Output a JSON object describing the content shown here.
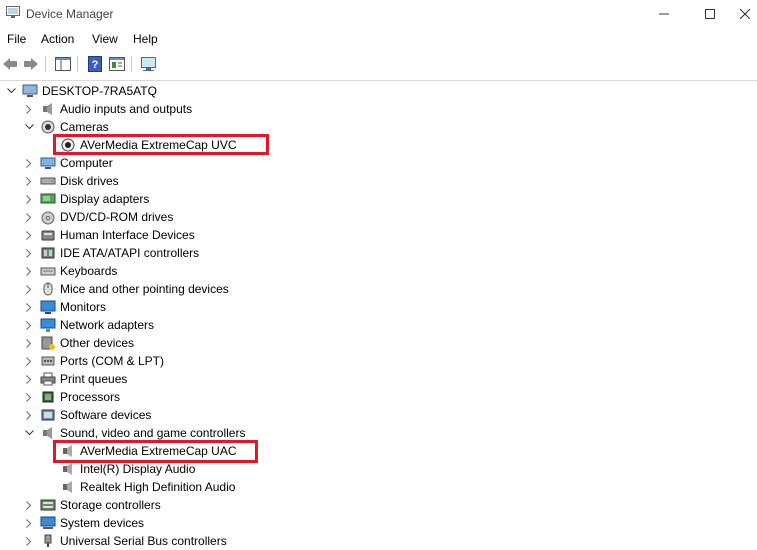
{
  "window": {
    "title": "Device Manager"
  },
  "menu": [
    "File",
    "Action",
    "View",
    "Help"
  ],
  "tree": {
    "root": "DESKTOP-7RA5ATQ",
    "items": [
      {
        "label": "Audio inputs and outputs",
        "icon": "speaker-icon",
        "expanded": false
      },
      {
        "label": "Cameras",
        "icon": "camera-icon",
        "expanded": true
      },
      {
        "label": "AVerMedia ExtremeCap UVC",
        "icon": "webcam-icon",
        "child": true
      },
      {
        "label": "Computer",
        "icon": "computer-icon",
        "expanded": false
      },
      {
        "label": "Disk drives",
        "icon": "disk-drive-icon",
        "expanded": false
      },
      {
        "label": "Display adapters",
        "icon": "display-adapter-icon",
        "expanded": false
      },
      {
        "label": "DVD/CD-ROM drives",
        "icon": "dvd-drive-icon",
        "expanded": false
      },
      {
        "label": "Human Interface Devices",
        "icon": "hid-icon",
        "expanded": false
      },
      {
        "label": "IDE ATA/ATAPI controllers",
        "icon": "ide-controller-icon",
        "expanded": false
      },
      {
        "label": "Keyboards",
        "icon": "keyboard-icon",
        "expanded": false
      },
      {
        "label": "Mice and other pointing devices",
        "icon": "mouse-icon",
        "expanded": false
      },
      {
        "label": "Monitors",
        "icon": "monitor-icon",
        "expanded": false
      },
      {
        "label": "Network adapters",
        "icon": "network-adapter-icon",
        "expanded": false
      },
      {
        "label": "Other devices",
        "icon": "other-devices-icon",
        "expanded": false
      },
      {
        "label": "Ports (COM & LPT)",
        "icon": "port-icon",
        "expanded": false
      },
      {
        "label": "Print queues",
        "icon": "printer-icon",
        "expanded": false
      },
      {
        "label": "Processors",
        "icon": "processor-icon",
        "expanded": false
      },
      {
        "label": "Software devices",
        "icon": "software-device-icon",
        "expanded": false
      },
      {
        "label": "Sound, video and game controllers",
        "icon": "sound-controller-icon",
        "expanded": true
      },
      {
        "label": "AVerMedia ExtremeCap UAC",
        "icon": "audio-device-icon",
        "child": true
      },
      {
        "label": "Intel(R) Display Audio",
        "icon": "audio-device-icon",
        "child": true
      },
      {
        "label": "Realtek High Definition Audio",
        "icon": "audio-device-icon",
        "child": true
      },
      {
        "label": "Storage controllers",
        "icon": "storage-controller-icon",
        "expanded": false
      },
      {
        "label": "System devices",
        "icon": "system-devices-icon",
        "expanded": false
      },
      {
        "label": "Universal Serial Bus controllers",
        "icon": "usb-icon",
        "expanded": false
      }
    ]
  },
  "colors": {
    "highlight": "#e0182a"
  }
}
